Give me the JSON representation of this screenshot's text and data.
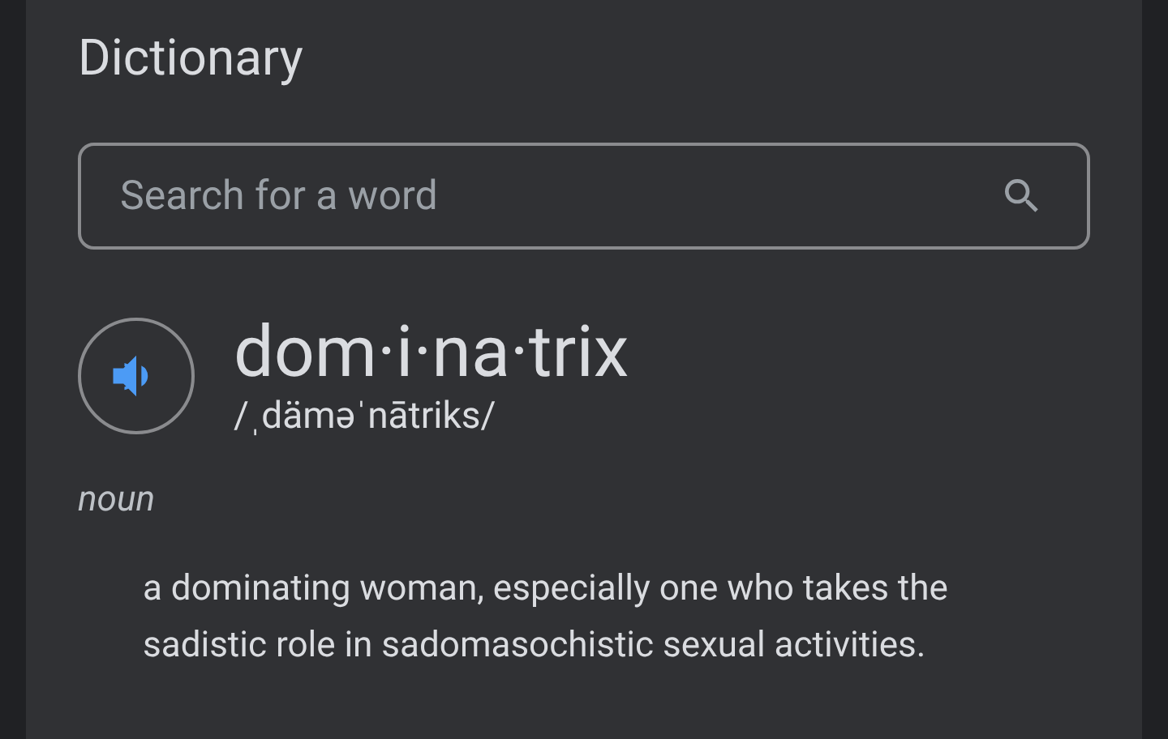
{
  "title": "Dictionary",
  "search": {
    "placeholder": "Search for a word"
  },
  "entry": {
    "word": "dom·i·na·trix",
    "pronunciation": "/ˌdäməˈnātriks/",
    "senses": [
      {
        "part_of_speech": "noun",
        "definitions": [
          "a dominating woman, especially one who takes the sadistic role in sadomasochistic sexual activities."
        ]
      }
    ]
  }
}
